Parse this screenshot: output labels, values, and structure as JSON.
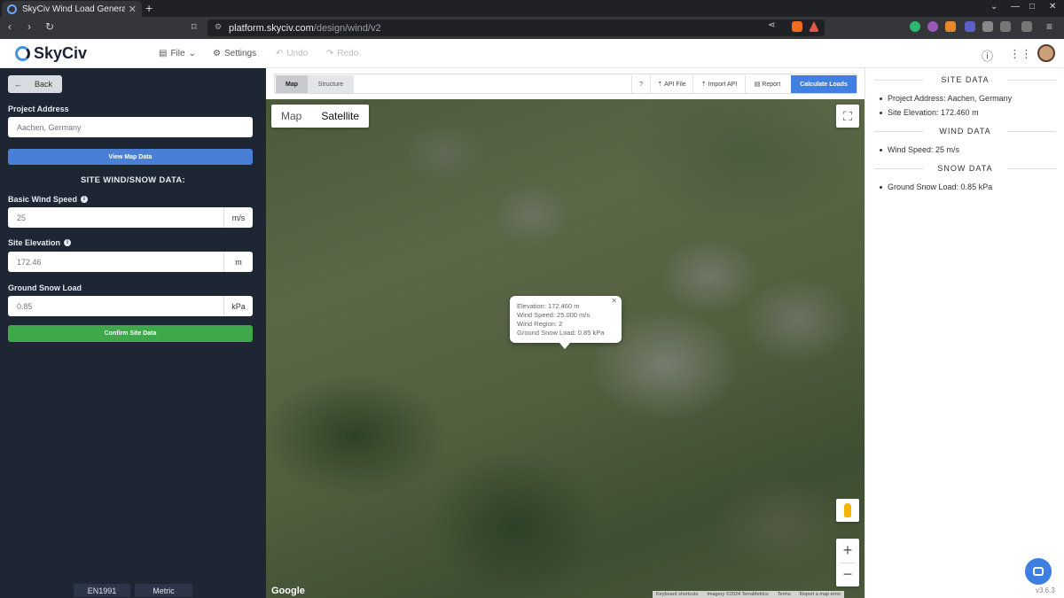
{
  "browser": {
    "tab_title": "SkyCiv Wind Load Genera",
    "url_host": "platform.skyciv.com",
    "url_path": "/design/wind/v2"
  },
  "header": {
    "brand": "SkyCiv",
    "menu": {
      "file": "File",
      "settings": "Settings",
      "undo": "Undo",
      "redo": "Redo"
    }
  },
  "sidebar": {
    "back_label": "Back",
    "project_address_label": "Project Address",
    "project_address_value": "Aachen, Germany",
    "view_map_button": "View Map Data",
    "section_title": "SITE WIND/SNOW DATA:",
    "wind_speed_label": "Basic Wind Speed",
    "wind_speed_value": "25",
    "wind_speed_unit": "m/s",
    "elevation_label": "Site Elevation",
    "elevation_value": "172.46",
    "elevation_unit": "m",
    "snow_label": "Ground Snow Load",
    "snow_value": "0.85",
    "snow_unit": "kPa",
    "confirm_button": "Confirm Site Data",
    "footer_code": "EN1991",
    "footer_units": "Metric"
  },
  "toolbar": {
    "tab_map": "Map",
    "tab_structure": "Structure",
    "help": "?",
    "api_file": "API File",
    "import_api": "Import API",
    "report": "Report",
    "calculate": "Calculate Loads"
  },
  "map": {
    "type_map": "Map",
    "type_satellite": "Satellite",
    "google": "Google",
    "credits": [
      "Keyboard shortcuts",
      "Imagery ©2024 TerraMetrics",
      "Terms",
      "Report a map error"
    ],
    "info_lines": [
      "Elevation: 172.460 m",
      "Wind Speed: 25.000 m/s",
      "Wind Region: 2",
      "Ground Snow Load: 0.85 kPa"
    ]
  },
  "right_panel": {
    "site_title": "SITE DATA",
    "site_items": [
      "Project Address: Aachen, Germany",
      "Site Elevation: 172.460 m"
    ],
    "wind_title": "WIND DATA",
    "wind_items": [
      "Wind Speed: 25 m/s"
    ],
    "snow_title": "SNOW DATA",
    "snow_items": [
      "Ground Snow Load: 0.85 kPa"
    ]
  },
  "version": "v3.6.3",
  "colors": {
    "sidebar_bg": "#1e2533",
    "primary": "#4a7fd6",
    "confirm": "#3fa84a"
  }
}
